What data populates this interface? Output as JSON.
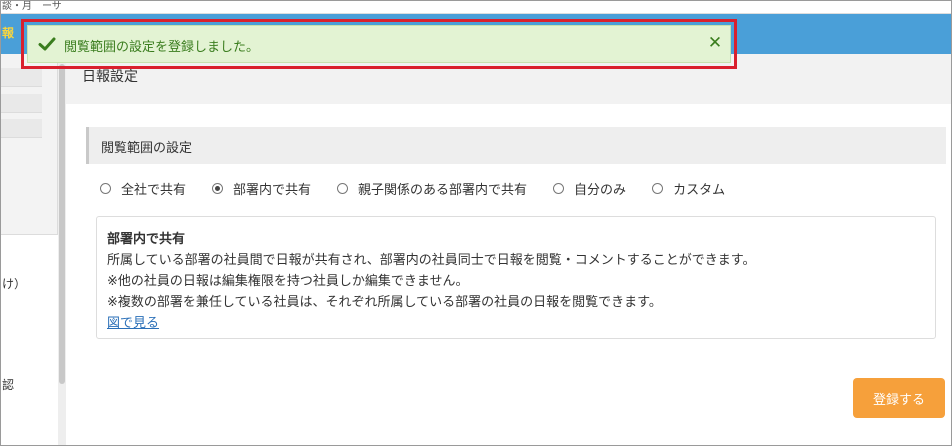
{
  "header": {
    "brand_fragment": "報",
    "top_fragment": "談・月　ーサ"
  },
  "sidebar": {
    "fragment_1": "け）",
    "fragment_2": "認"
  },
  "notification": {
    "message": "閲覧範囲の設定を登録しました。",
    "close_glyph": "✕",
    "color": "#3a7d1e"
  },
  "page": {
    "title": "日報設定"
  },
  "scope_section": {
    "heading": "閲覧範囲の設定",
    "options": [
      {
        "label": "全社で共有",
        "checked": false
      },
      {
        "label": "部署内で共有",
        "checked": true
      },
      {
        "label": "親子関係のある部署内で共有",
        "checked": false
      },
      {
        "label": "自分のみ",
        "checked": false
      },
      {
        "label": "カスタム",
        "checked": false
      }
    ],
    "description": {
      "title": "部署内で共有",
      "lines": [
        "所属している部署の社員間で日報が共有され、部署内の社員同士で日報を閲覧・コメントすることができます。",
        "※他の社員の日報は編集権限を持つ社員しか編集できません。",
        "※複数の部署を兼任している社員は、それぞれ所属している部署の社員の日報を閲覧できます。"
      ],
      "link": "図で見る"
    }
  },
  "actions": {
    "register_label": "登録する",
    "register_color": "#f6a03b"
  },
  "colors": {
    "header": "#4a9fd8",
    "highlight_outline": "#d9202d"
  }
}
